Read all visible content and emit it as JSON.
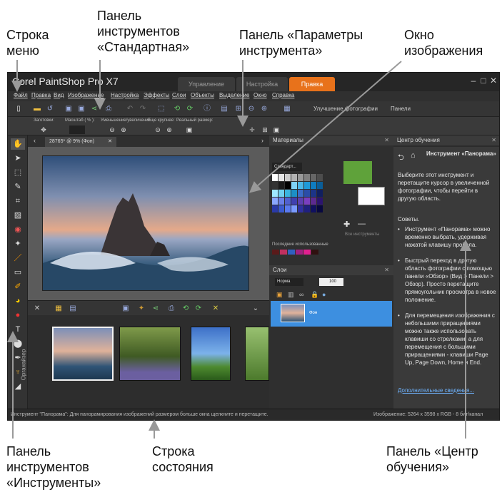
{
  "callouts": {
    "menu_bar": "Строка\nменю",
    "standard_toolbar": "Панель\nинструментов\n«Стандартная»",
    "tool_options": "Панель «Параметры\nинструмента»",
    "image_window": "Окно\nизображения",
    "tools_toolbar": "Панель\nинструментов\n«Инструменты»",
    "status_bar": "Строка\nсостояния",
    "learning_center": "Панель «Центр\nобучения»"
  },
  "window": {
    "title": "Corel PaintShop Pro X7",
    "workspace_tabs": [
      "Управление",
      "Настройка",
      "Правка"
    ],
    "active_tab": "Правка"
  },
  "menu": [
    "Файл",
    "Правка",
    "Вид",
    "Изображение",
    "Настройка",
    "Эффекты",
    "Слои",
    "Объекты",
    "Выделение",
    "Окно",
    "Справка"
  ],
  "standard_toolbar": {
    "enhance_photo": "Улучшение фотографии",
    "palettes": "Панели"
  },
  "tool_options": {
    "labels": [
      "Заготовки:",
      "Масштаб ( % ):",
      "Уменьшение/увеличение:",
      "Еще крупнее:",
      "Реальный размер:"
    ]
  },
  "document": {
    "tab_label": "28765* @ 9% (Фон)"
  },
  "organizer": {
    "label": "Органайзер"
  },
  "materials": {
    "title": "Материалы",
    "mode": "Стандарт...",
    "all_tools": "Все инструменты",
    "recent_label": "Последние использованные"
  },
  "layers": {
    "title": "Слои",
    "blend_mode": "Норма",
    "opacity": "100",
    "layer_name": "Фон"
  },
  "learning_center": {
    "title": "Центр обучения",
    "tool_name": "Инструмент «Панорама»",
    "intro": "Выберите этот инструмент и перетащите курсор в увеличенной фотографии, чтобы перейти в другую область.",
    "tips_title": "Советы.",
    "tips": [
      "Инструмент «Панорама» можно временно выбрать, удерживая нажатой клавишу пробела.",
      "Быстрый переход в другую область фотографии с помощью панели «Обзор» (Вид > Панели > Обзор). Просто перетащите прямоугольник просмотра в новое положение.",
      "Для перемещения изображения с небольшими приращениями можно также использовать клавиши со стрелками, а для перемещения с большими приращениями - клавиши Page Up, Page Down, Home и End."
    ],
    "more_link": "Дополнительные сведения..."
  },
  "status": {
    "left": "Инструмент \"Панорама\": Для панорамирования изображений размером больше окна щелкните и перетащите.",
    "right": "Изображение: 5264 x 3598 x RGB - 8 бит/канал"
  },
  "colors": {
    "accent": "#e8721b",
    "foreground": "#5fa23a",
    "layer_selected": "#3d8fe0",
    "link": "#6fb4ff"
  }
}
